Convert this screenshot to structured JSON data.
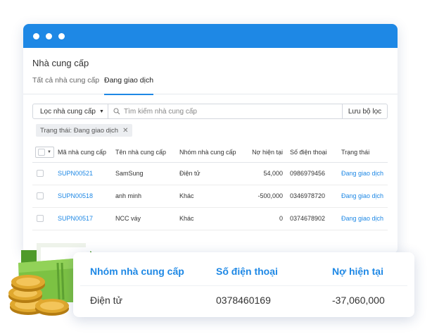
{
  "window": {
    "title": "Nhà cung cấp"
  },
  "tabs": [
    {
      "label": "Tất cả nhà cung cấp",
      "active": false
    },
    {
      "label": "Đang giao dịch",
      "active": true
    }
  ],
  "filter": {
    "select_label": "Lọc nhà cung cấp",
    "search_placeholder": "Tìm kiếm nhà cung cấp",
    "save_label": "Lưu bộ lọc",
    "chip_label": "Trạng thái: Đang giao dịch"
  },
  "table": {
    "headers": [
      "Mã nhà cung cấp",
      "Tên nhà cung cấp",
      "Nhóm nhà cung cấp",
      "Nợ hiện tại",
      "Số điện thoại",
      "Trạng thái"
    ],
    "rows": [
      {
        "code": "SUPN00521",
        "name": "SamSung",
        "group": "Điện tử",
        "debt": "54,000",
        "phone": "0986979456",
        "status": "Đang giao dịch"
      },
      {
        "code": "SUPN00518",
        "name": "anh minh",
        "group": "Khác",
        "debt": "-500,000",
        "phone": "0346978720",
        "status": "Đang giao dịch"
      },
      {
        "code": "SUPN00517",
        "name": "NCC váy",
        "group": "Khác",
        "debt": "0",
        "phone": "0374678902",
        "status": "Đang giao dịch"
      }
    ]
  },
  "highlight": {
    "headers": [
      "Nhóm nhà cung cấp",
      "Số điện thoại",
      "Nợ hiện tại"
    ],
    "values": [
      "Điện tử",
      "0378460169",
      "-37,060,000"
    ]
  },
  "colors": {
    "accent": "#1e88e5",
    "folder": "#7cc243",
    "coin": "#e0a82e"
  },
  "icons": [
    "window-dot-icon",
    "caret-down-icon",
    "search-icon",
    "close-icon",
    "checkbox-icon",
    "folder-icon",
    "coins-icon"
  ]
}
